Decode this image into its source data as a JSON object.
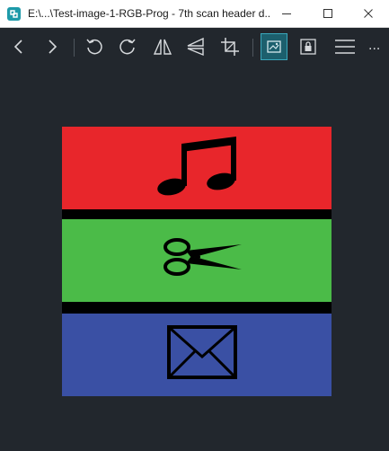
{
  "window": {
    "title": "E:\\...\\Test-image-1-RGB-Prog - 7th scan header d..."
  },
  "titlebar_controls": {
    "minimize_icon": "minimize-icon",
    "maximize_icon": "maximize-icon",
    "close_icon": "close-icon"
  },
  "toolbar": {
    "buttons": [
      {
        "name": "previous",
        "icon": "chevron-left-icon"
      },
      {
        "name": "next",
        "icon": "chevron-right-icon"
      },
      {
        "name": "rotate-left",
        "icon": "rotate-ccw-icon"
      },
      {
        "name": "rotate-right",
        "icon": "rotate-cw-icon"
      },
      {
        "name": "flip-horizontal",
        "icon": "flip-horizontal-icon"
      },
      {
        "name": "flip-vertical",
        "icon": "flip-vertical-icon"
      },
      {
        "name": "crop",
        "icon": "crop-icon"
      },
      {
        "name": "view-mode",
        "icon": "image-view-icon",
        "active": true
      },
      {
        "name": "lock",
        "icon": "lock-icon"
      },
      {
        "name": "menu",
        "icon": "hamburger-menu-icon"
      }
    ],
    "more_label": "..."
  },
  "image": {
    "bands": [
      {
        "color": "#e8262b",
        "icon": "music-note-icon"
      },
      {
        "color": "#4bbb48",
        "icon": "scissors-icon"
      },
      {
        "color": "#3a50a4",
        "icon": "envelope-icon"
      }
    ],
    "separator_color": "#000000"
  },
  "colors": {
    "background": "#22272d",
    "accent": "#1d9aa9",
    "active_button": "#1c5f6d"
  }
}
